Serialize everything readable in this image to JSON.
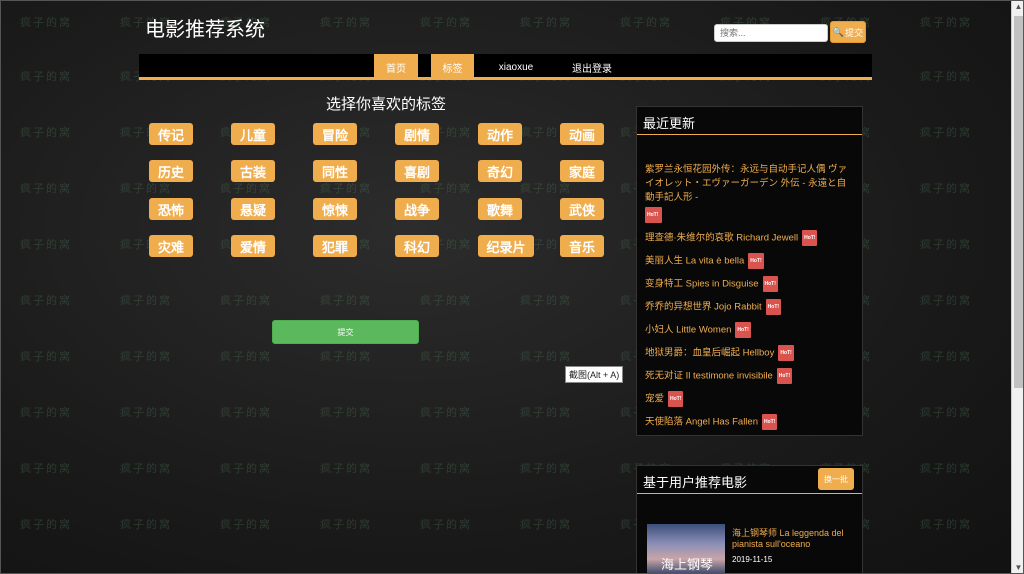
{
  "header": {
    "site_title": "电影推荐系统"
  },
  "search": {
    "placeholder": "搜索...",
    "button_label": "提交"
  },
  "nav": {
    "items": [
      "首页",
      "标签",
      "xiaoxue",
      "退出登录"
    ]
  },
  "tags": {
    "title": "选择你喜欢的标签",
    "items": [
      "传记",
      "儿童",
      "冒险",
      "剧情",
      "动作",
      "动画",
      "历史",
      "古装",
      "同性",
      "喜剧",
      "奇幻",
      "家庭",
      "恐怖",
      "悬疑",
      "惊悚",
      "战争",
      "歌舞",
      "武侠",
      "灾难",
      "爱情",
      "犯罪",
      "科幻",
      "纪录片",
      "音乐"
    ],
    "submit_label": "提交"
  },
  "screenshot_tip": "截图(Alt + A)",
  "recent": {
    "title": "最近更新",
    "hot_label": "HoT!",
    "items": [
      "紫罗兰永恒花园外传：永远与自动手记人偶 ヴァイオレット・エヴァーガーデン 外伝 - 永遠と自動手記人形 -",
      "理查德·朱维尔的哀歌 Richard Jewell",
      "美丽人生 La vita è bella",
      "变身特工 Spies in Disguise",
      "乔乔的异想世界 Jojo Rabbit",
      "小妇人 Little Women",
      "地狱男爵：血皇后崛起 Hellboy",
      "死无对证 Il testimone invisibile",
      "宠爱",
      "天使陷落 Angel Has Fallen"
    ]
  },
  "user_rec": {
    "title": "基于用户推荐电影",
    "change_label": "换一批",
    "movie": {
      "title": "海上钢琴师 La leggenda del pianista sull'oceano",
      "date": "2019-11-15",
      "poster_text": "海上钢琴师"
    }
  },
  "watermark": "疯子的窝",
  "colors": {
    "accent": "#f0ad4e",
    "success": "#5cb85c",
    "hot": "#d9534f",
    "background": "#1e1e1e"
  }
}
